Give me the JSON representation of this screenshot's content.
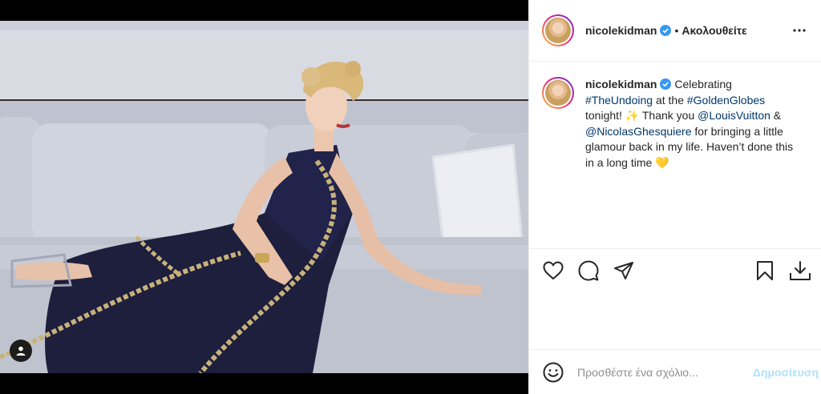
{
  "post": {
    "username": "nicolekidman",
    "follow_status": "Ακολουθείτε",
    "separator": "•",
    "caption": {
      "username": "nicolekidman",
      "text_1": " Celebrating ",
      "hashtag_1": "#TheUndoing",
      "text_2": " at the ",
      "hashtag_2": "#GoldenGlobes",
      "text_3": " tonight! ✨ Thank you ",
      "mention_1": "@LouisVuitton",
      "text_4": " & ",
      "mention_2": "@NicolasGhesquiere",
      "text_5": " for bringing a little glamour back in my life. Haven’t done this in a long time 💛"
    }
  },
  "comment": {
    "placeholder": "Προσθέστε ένα σχόλιο...",
    "post_label": "Δημοσίευση"
  },
  "icons": {
    "more": "more-options-icon",
    "like": "heart-icon",
    "comment": "comment-icon",
    "share": "send-icon",
    "save": "bookmark-icon",
    "download": "download-icon",
    "emoji": "emoji-icon",
    "tagged": "user-tag-icon",
    "verified": "verified-badge-icon"
  },
  "colors": {
    "verified": "#3897f0",
    "link": "#00376b",
    "post_button": "#b2dffc",
    "border": "#efefef"
  }
}
